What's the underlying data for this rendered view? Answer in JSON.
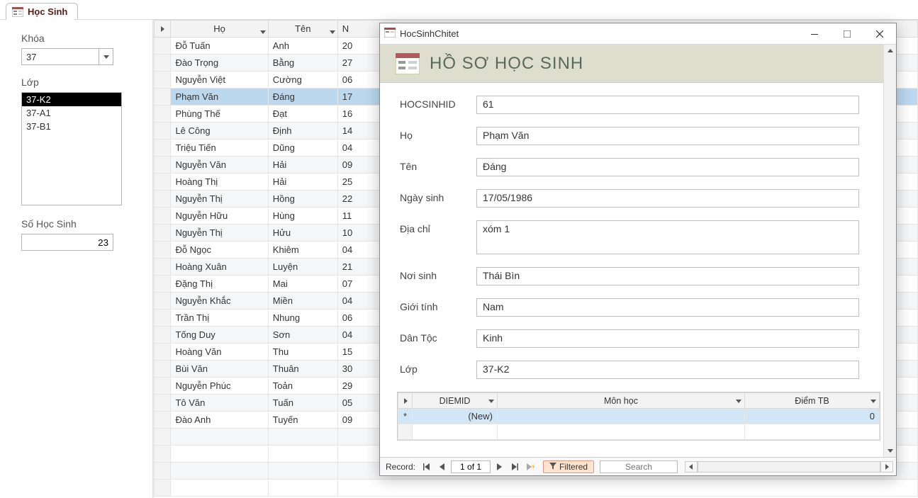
{
  "tab": {
    "title": "Học Sinh"
  },
  "filter": {
    "khoa_label": "Khóa",
    "khoa_value": "37",
    "lop_label": "Lớp",
    "lop_items": [
      "37-K2",
      "37-A1",
      "37-B1"
    ],
    "lop_selected_index": 0,
    "sohs_label": "Số Học Sinh",
    "sohs_value": "23"
  },
  "datasheet": {
    "col_ho": "Họ",
    "col_ten": "Tên",
    "col_n": "N",
    "rows": [
      {
        "ho": "Đỗ Tuấn",
        "ten": "Anh",
        "n": "20"
      },
      {
        "ho": "Đào Trọng",
        "ten": "Bằng",
        "n": "27"
      },
      {
        "ho": "Nguyễn Việt",
        "ten": "Cường",
        "n": "06"
      },
      {
        "ho": "Phạm Văn",
        "ten": "Đáng",
        "n": "17",
        "selected": true
      },
      {
        "ho": "Phùng Thế",
        "ten": "Đạt",
        "n": "16"
      },
      {
        "ho": "Lê Công",
        "ten": "Định",
        "n": "14"
      },
      {
        "ho": "Triệu Tiến",
        "ten": "Dũng",
        "n": "04"
      },
      {
        "ho": "Nguyễn Văn",
        "ten": "Hải",
        "n": "09"
      },
      {
        "ho": "Hoàng Thị",
        "ten": "Hải",
        "n": "25"
      },
      {
        "ho": "Nguyễn Thị",
        "ten": "Hồng",
        "n": "22"
      },
      {
        "ho": "Nguyễn Hữu",
        "ten": "Hùng",
        "n": "11"
      },
      {
        "ho": "Nguyễn Thị",
        "ten": "Hửu",
        "n": "10"
      },
      {
        "ho": "Đỗ Ngọc",
        "ten": "Khiêm",
        "n": "04"
      },
      {
        "ho": "Hoàng Xuân",
        "ten": "Luyện",
        "n": "21"
      },
      {
        "ho": "Đặng Thị",
        "ten": "Mai",
        "n": "07"
      },
      {
        "ho": "Nguyễn Khắc",
        "ten": "Miền",
        "n": "04"
      },
      {
        "ho": "Trần Thị",
        "ten": "Nhung",
        "n": "06"
      },
      {
        "ho": "Tống Duy",
        "ten": "Sơn",
        "n": "04"
      },
      {
        "ho": "Hoàng Văn",
        "ten": "Thu",
        "n": "15"
      },
      {
        "ho": "Bùi Văn",
        "ten": "Thuân",
        "n": "30"
      },
      {
        "ho": "Nguyễn Phúc",
        "ten": "Toản",
        "n": "29"
      },
      {
        "ho": "Tô Văn",
        "ten": "Tuấn",
        "n": "05"
      },
      {
        "ho": "Đào Anh",
        "ten": "Tuyến",
        "n": "09"
      }
    ]
  },
  "popup": {
    "window_title": "HocSinhChitet",
    "header_title": "HỒ SƠ HỌC SINH",
    "fields": {
      "hocsinhid_label": "HOCSINHID",
      "hocsinhid": "61",
      "ho_label": "Họ",
      "ho": "Phạm Văn",
      "ten_label": "Tên",
      "ten": "Đáng",
      "ngaysinh_label": "Ngày sinh",
      "ngaysinh": "17/05/1986",
      "diachi_label": "Địa chỉ",
      "diachi": "xóm 1 ",
      "noisinh_label": "Nơi sinh",
      "noisinh": "Thái Bìn",
      "gioitinh_label": "Giới tính",
      "gioitinh": "Nam",
      "dantoc_label": "Dân Tộc",
      "dantoc": "Kinh",
      "lop_label": "Lớp",
      "lop": "37-K2"
    },
    "subds": {
      "col_diemid": "DIEMID",
      "col_monhoc": "Môn học",
      "col_diemtb": "Điểm TB",
      "new_label": "(New)",
      "diemtb_default": "0"
    },
    "recnav": {
      "record_label": "Record:",
      "position": "1 of 1",
      "filtered_label": "Filtered",
      "search_placeholder": "Search"
    }
  }
}
